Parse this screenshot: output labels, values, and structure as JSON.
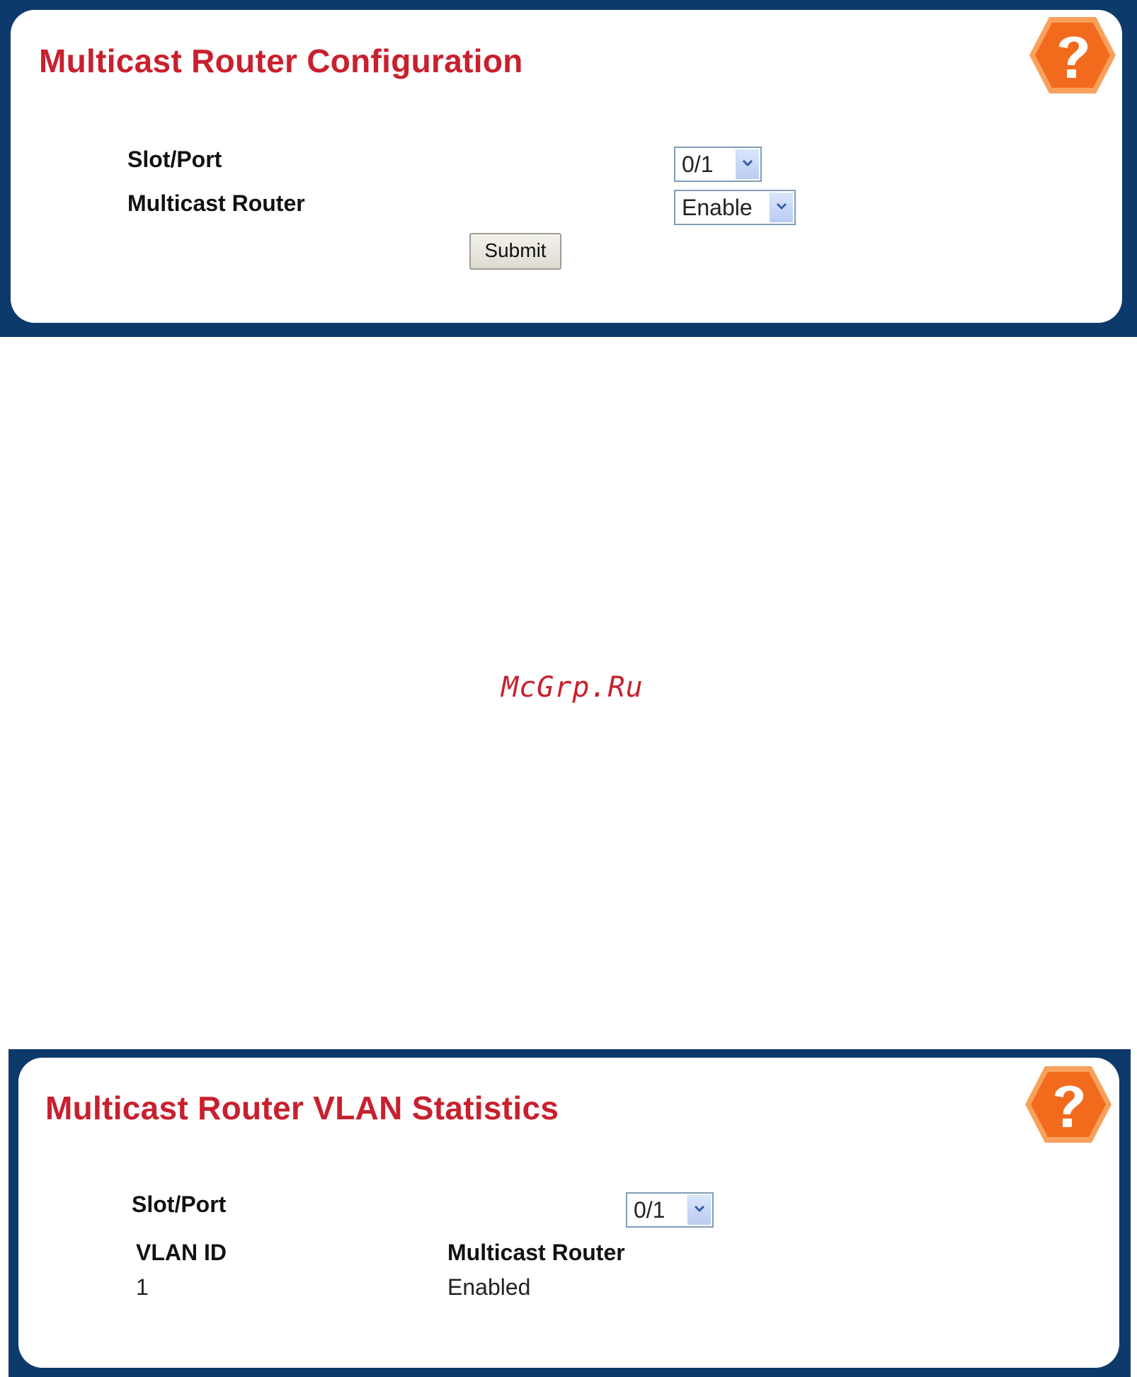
{
  "config_panel": {
    "title": "Multicast Router Configuration",
    "slot_port_label": "Slot/Port",
    "slot_port_value": "0/1",
    "multicast_router_label": "Multicast Router",
    "multicast_router_value": "Enable",
    "submit_label": "Submit",
    "help_icon": "help-hexagon-icon"
  },
  "watermark": "McGrp.Ru",
  "stats_panel": {
    "title": "Multicast Router VLAN Statistics",
    "slot_port_label": "Slot/Port",
    "slot_port_value": "0/1",
    "table": {
      "columns": [
        "VLAN ID",
        "Multicast Router"
      ],
      "rows": [
        [
          "1",
          "Enabled"
        ]
      ]
    },
    "help_icon": "help-hexagon-icon"
  },
  "colors": {
    "frame": "#0d3a6b",
    "title_red": "#c8202e",
    "help_orange": "#f26b1d"
  }
}
